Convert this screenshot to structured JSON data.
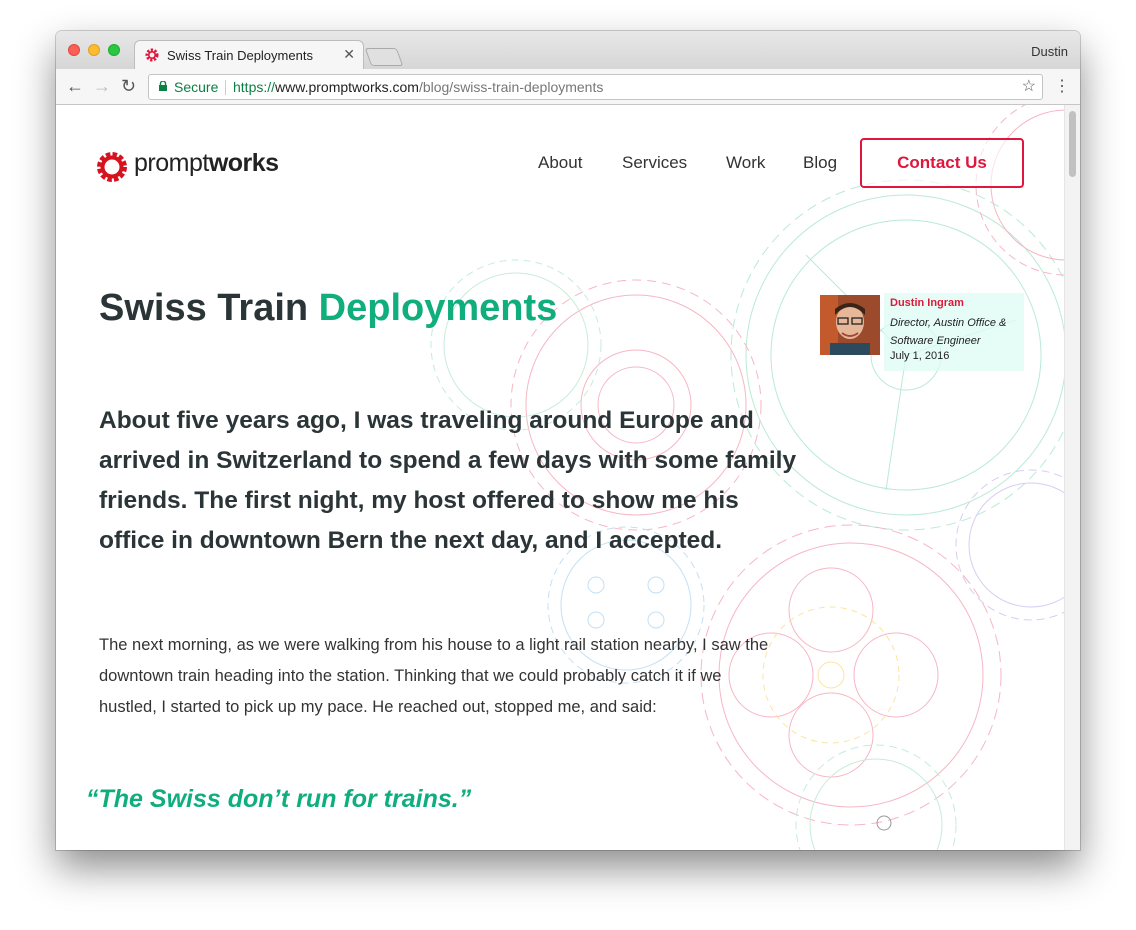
{
  "browser": {
    "tab_title": "Swiss Train Deployments",
    "profile_name": "Dustin",
    "secure_label": "Secure",
    "url_scheme": "https://",
    "url_host": "www.promptworks.com",
    "url_path": "/blog/swiss-train-deployments"
  },
  "site": {
    "logo_regular": "prompt",
    "logo_bold": "works",
    "nav": [
      "About",
      "Services",
      "Work",
      "Blog"
    ],
    "cta_label": "Contact Us",
    "brand_color": "#e0173c",
    "accent_color": "#10ae7d"
  },
  "article": {
    "title_plain": "Swiss Train ",
    "title_accent": "Deployments",
    "author_name": "Dustin Ingram",
    "author_role": "Director, Austin Office & Software Engineer",
    "date": "July 1, 2016",
    "lede": "About five years ago, I was traveling around Europe and arrived in Switzerland to spend a few days with some family friends. The first night, my host offered to show me his office in downtown Bern the next day, and I accepted.",
    "paragraph": "The next morning, as we were walking from his house to a light rail station nearby, I saw the downtown train heading into the station. Thinking that we could probably catch it if we hustled, I started to pick up my pace. He reached out, stopped me, and said:",
    "quote": "“The Swiss don’t run for trains.”"
  }
}
